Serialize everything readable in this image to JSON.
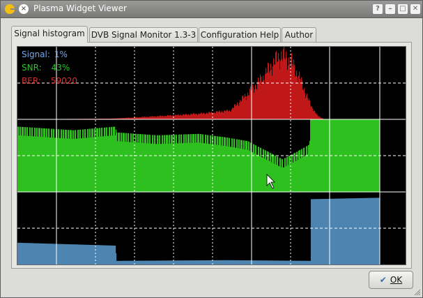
{
  "window": {
    "title": "Plasma Widget Viewer"
  },
  "titlebar_buttons": {
    "help": "?",
    "minimize": "–",
    "maximize": "□",
    "close": "✕"
  },
  "tabs": [
    {
      "label": "Signal histogram",
      "active": true
    },
    {
      "label": "DVB Signal Monitor 1.3-3",
      "active": false
    },
    {
      "label": "Configuration Help",
      "active": false
    },
    {
      "label": "Author",
      "active": false
    }
  ],
  "readouts": {
    "signal": {
      "label": "Signal:",
      "value": "1%",
      "color": "#78a8e8"
    },
    "snr": {
      "label": "SNR:",
      "value": "43%",
      "color": "#30c030"
    },
    "ber": {
      "label": "BER:",
      "value": "59020",
      "color": "#d03030"
    }
  },
  "colors": {
    "ber_fill": "#c01818",
    "snr_fill": "#2ec01e",
    "signal_fill": "#4d85b0",
    "grid": "#ffffff"
  },
  "chart_data": {
    "type": "area",
    "sample_count": 520,
    "series": [
      {
        "key": "ber",
        "segments": [
          [
            0,
            0.0
          ],
          [
            135,
            0.01
          ],
          [
            175,
            0.03
          ],
          [
            215,
            0.05
          ],
          [
            265,
            0.08
          ],
          [
            305,
            0.12
          ],
          [
            330,
            0.35
          ],
          [
            350,
            0.55
          ],
          [
            365,
            0.75
          ],
          [
            378,
            0.88
          ],
          [
            392,
            0.8
          ],
          [
            405,
            0.55
          ],
          [
            420,
            0.2
          ],
          [
            430,
            0.05
          ],
          [
            440,
            0.0
          ]
        ]
      },
      {
        "key": "snr",
        "segments": [
          [
            0,
            0.9
          ],
          [
            80,
            0.85
          ],
          [
            140,
            0.9
          ],
          [
            142,
            0.82
          ],
          [
            200,
            0.78
          ],
          [
            260,
            0.8
          ],
          [
            300,
            0.75
          ],
          [
            330,
            0.7
          ],
          [
            350,
            0.6
          ],
          [
            380,
            0.45
          ],
          [
            400,
            0.55
          ],
          [
            418,
            0.65
          ],
          [
            420,
            1.0
          ],
          [
            520,
            1.0
          ]
        ]
      },
      {
        "key": "signal",
        "segments": [
          [
            0,
            0.3
          ],
          [
            140,
            0.26
          ],
          [
            142,
            0.05
          ],
          [
            300,
            0.06
          ],
          [
            420,
            0.05
          ],
          [
            421,
            0.9
          ],
          [
            520,
            0.92
          ]
        ]
      }
    ]
  },
  "ok_button": {
    "label": "OK"
  }
}
